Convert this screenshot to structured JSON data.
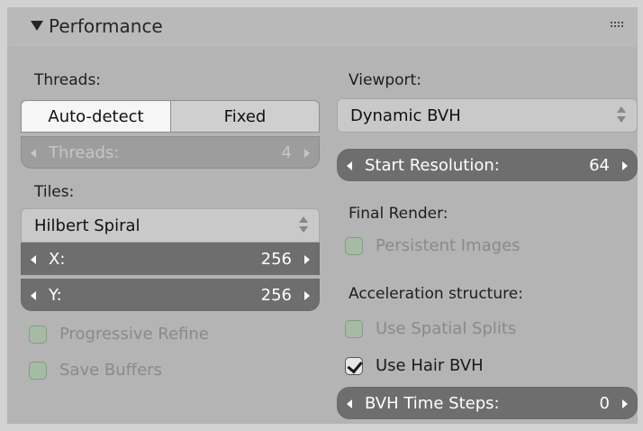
{
  "panel": {
    "title": "Performance"
  },
  "threads": {
    "label": "Threads:",
    "mode_options": [
      "Auto-detect",
      "Fixed"
    ],
    "selected_mode": "Auto-detect",
    "field_label": "Threads:",
    "field_value": "4"
  },
  "tiles": {
    "label": "Tiles:",
    "order": "Hilbert Spiral",
    "x_label": "X:",
    "x_value": "256",
    "y_label": "Y:",
    "y_value": "256"
  },
  "left_checks": [
    {
      "label": "Progressive Refine",
      "checked": false
    },
    {
      "label": "Save Buffers",
      "checked": false
    }
  ],
  "viewport": {
    "label": "Viewport:",
    "mode": "Dynamic BVH",
    "start_res_label": "Start Resolution:",
    "start_res_value": "64"
  },
  "final_render": {
    "label": "Final Render:",
    "persistent_images": "Persistent Images"
  },
  "acceleration": {
    "label": "Acceleration structure:",
    "spatial_splits": "Use Spatial Splits",
    "hair_bvh": "Use Hair BVH",
    "hair_bvh_checked": true,
    "bvh_steps_label": "BVH Time Steps:",
    "bvh_steps_value": "0"
  }
}
